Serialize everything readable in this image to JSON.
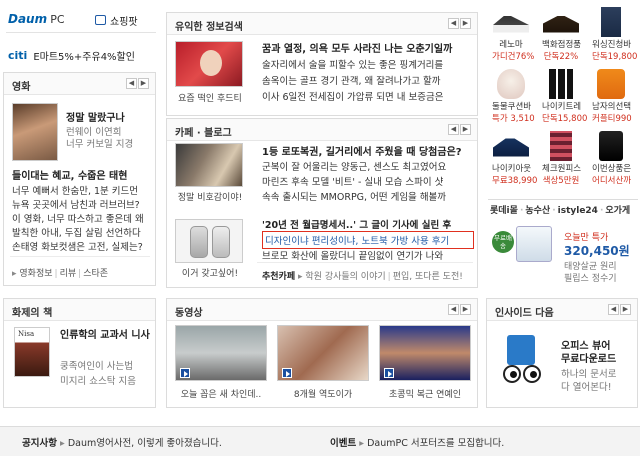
{
  "top": {
    "daum_pc": "PC",
    "shopping": "쇼핑팟",
    "citi": "citi",
    "promo": "E마트5%+주유4%할인"
  },
  "movie": {
    "title": "영화",
    "feature_title": "정말 말랐구나",
    "feature_lines": [
      "런웨이 이연희",
      "너무 커보일 지경"
    ],
    "headline": "들이대는 혜교, 수줍은 태현",
    "items": [
      "너무 예뻐서 한숨만, 1분 키드먼",
      "뉴욕 곳곳에서 남친과 러브러브?",
      "이 영화, 너무 따스하고 좋은데 왜",
      "발칙한 아내, 두집 살림 선언하다",
      "손태영 화보컷샘은 고전, 실제는?"
    ],
    "footer": [
      "영화정보",
      "리뷰",
      "스타존"
    ]
  },
  "info": {
    "title": "유익한 정보검색",
    "caption": "요즘 떡인 후드티",
    "headline": "꿈과 열정, 의욕 모두 사라진 나는 오춘기일까",
    "lines": [
      "술자리에서 술을 피할수 있는 좋은 핑계거리를",
      "솜옥이는 골프 경기 관객, 왜 잘려나가고 할까",
      "이사 6일전 전세집이 가압류 되면 내 보증금은"
    ]
  },
  "cafe": {
    "title": "카페 · 블로그",
    "caption1": "정말 비호감이야!",
    "headline": "1등 로또복권, 길거리에서 주웠을 때 당첨금은?",
    "lines": [
      "군복이 잘 어울리는 양동근, 센스도 최고였어요",
      "마린즈 후속 모델 '비트' - 실내 모습 스파이 샷",
      "속속 출시되는 MMORPG, 어떤 게임을 해볼까"
    ],
    "caption2": "이거 갖고싶어!",
    "headline2": "'20년 전 월급명세서..' 그 글이 기사에 실린 후",
    "highlight": "디자인이냐 편리성이냐, 노트북 가방 사용 후기",
    "line3": "브로모 화산에 올랐더니 끝임없이 연기가 나와",
    "rec_label": "추천카페",
    "rec_items": [
      "학원 강사들의 이야기",
      "편입, 또다른 도전!"
    ]
  },
  "shop": {
    "items": [
      {
        "name": "레노마",
        "price": "가디건76%"
      },
      {
        "name": "백화점정품",
        "price": "단독22%"
      },
      {
        "name": "워싱진청바",
        "price": "단독19,800"
      },
      {
        "name": "둘물쿠션바",
        "price": "특가 3,510"
      },
      {
        "name": "나이키트레",
        "price": "단독15,800"
      },
      {
        "name": "남자의선택",
        "price": "커플티990"
      },
      {
        "name": "나이키아웃",
        "price": "무료38,990"
      },
      {
        "name": "체크원피스",
        "price": "색상5만원"
      },
      {
        "name": "이번상품은",
        "price": "어디서산까"
      }
    ],
    "tabs": [
      "롯데i몰",
      "농수산",
      "istyle24",
      "오가게"
    ],
    "badge": "무료배송",
    "product_label": "오늘만 특가",
    "product_price": "320,450원",
    "product_desc": "태양살균 원리",
    "product_brand": "필립스 정수기"
  },
  "book": {
    "title": "화제의 책",
    "cover": "Nisa",
    "name": "인류학의 교과서 니사",
    "lines": [
      "쿵족여인이 사는법",
      "미지리 쇼스탁 지음"
    ]
  },
  "video": {
    "title": "동영상",
    "captions": [
      "오늘 꼽은 새 차인데..",
      "8개월 역도이가",
      "초콩믹 복근 연예인"
    ]
  },
  "inside": {
    "title": "인사이드 다음",
    "name": "오피스 뷰어",
    "name2": "무료다운로드",
    "lines": [
      "하나의 문서로",
      "다 열어본다!"
    ]
  },
  "notice": {
    "label": "공지사항",
    "text": "Daum영어사전, 이렇게 좋아졌습니다.",
    "event_label": "이벤트",
    "event_text": "DaumPC 서포터즈를 모집합니다."
  },
  "colors": {
    "accent": "#1f5aa6",
    "highlight": "#e0301f",
    "brand_blue": "#0060aa"
  },
  "icons": [
    "daum-logo",
    "cart-icon",
    "arrow-left-icon",
    "arrow-right-icon",
    "play-icon"
  ]
}
